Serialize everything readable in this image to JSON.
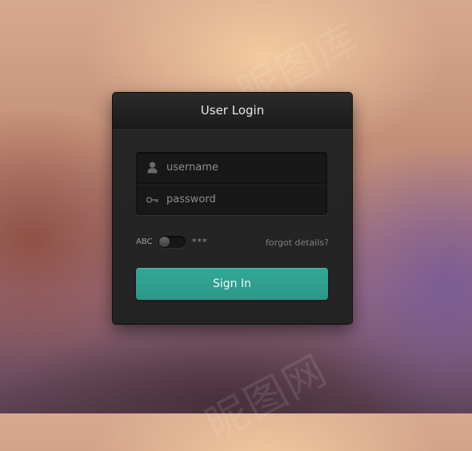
{
  "login": {
    "title": "User Login",
    "username": {
      "placeholder": "username",
      "icon": "user-icon"
    },
    "password": {
      "placeholder": "password",
      "icon": "key-icon"
    },
    "toggle": {
      "left_label": "ABC",
      "right_label": "***",
      "state": "off"
    },
    "forgot_label": "forgot details?",
    "submit_label": "Sign In"
  },
  "colors": {
    "accent": "#2f9f8f",
    "card": "#232323"
  }
}
